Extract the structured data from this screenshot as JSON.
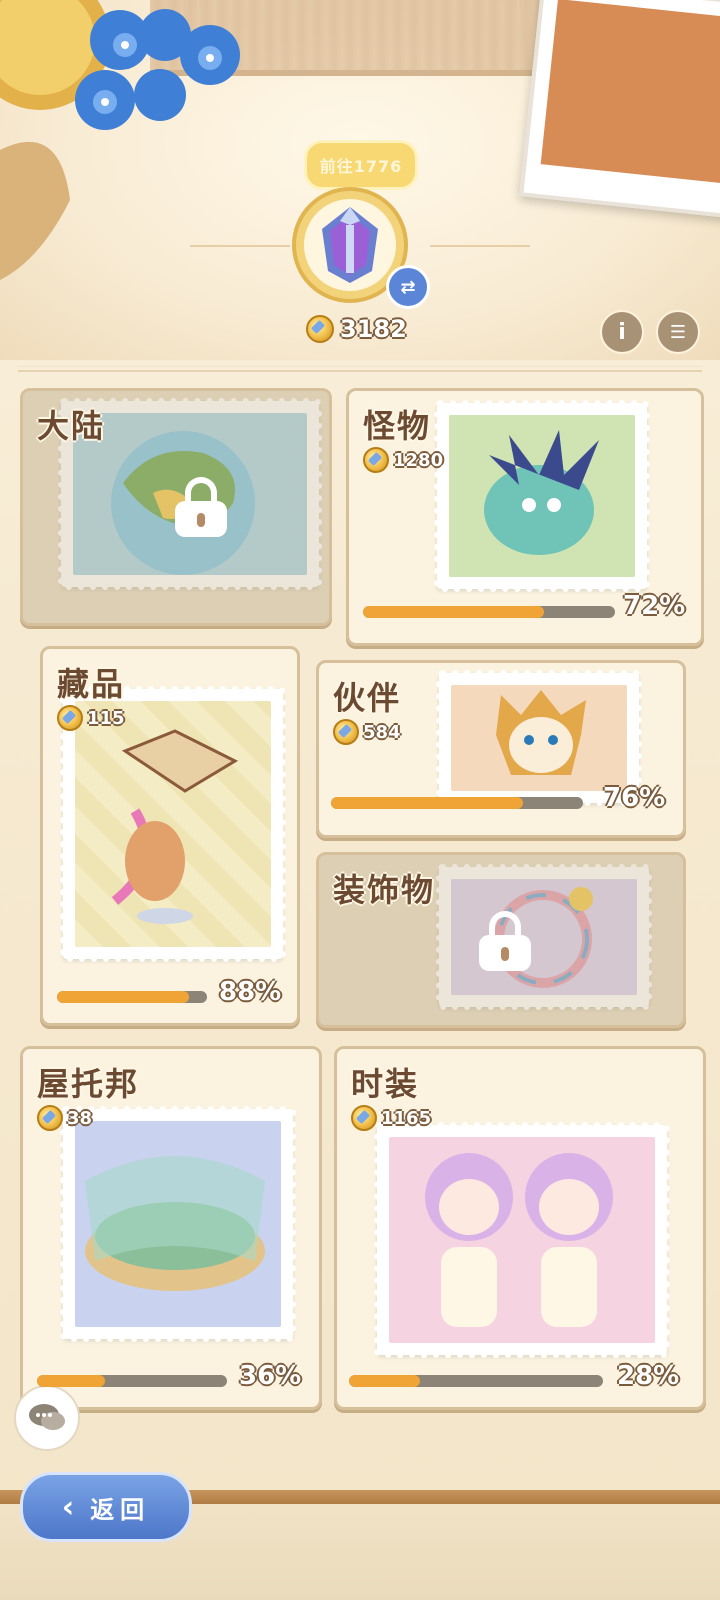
{
  "header": {
    "bubble_text": "前往1776",
    "currency_total": "3182",
    "icons": {
      "info": "info-icon",
      "list": "list-icon",
      "swap": "swap-icon",
      "currency": "star-coin-icon"
    }
  },
  "cards": {
    "continent": {
      "title": "大陆",
      "locked": true
    },
    "monster": {
      "title": "怪物",
      "cost": "1280",
      "progress": 72,
      "progress_label": "72%"
    },
    "collection": {
      "title": "藏品",
      "cost": "115",
      "progress": 88,
      "progress_label": "88%"
    },
    "partner": {
      "title": "伙伴",
      "cost": "584",
      "progress": 76,
      "progress_label": "76%"
    },
    "decoration": {
      "title": "装饰物",
      "locked": true
    },
    "utopia": {
      "title": "屋托邦",
      "cost": "38",
      "progress": 36,
      "progress_label": "36%"
    },
    "outfit": {
      "title": "时装",
      "cost": "1165",
      "progress": 28,
      "progress_label": "28%"
    }
  },
  "footer": {
    "back_label": "返回",
    "chat_icon": "chat-bubble-icon"
  },
  "colors": {
    "progress_fill": "#f0a436",
    "progress_track": "#8d8478",
    "title_text": "#6b4a31",
    "back_button": "#5b86d8"
  }
}
